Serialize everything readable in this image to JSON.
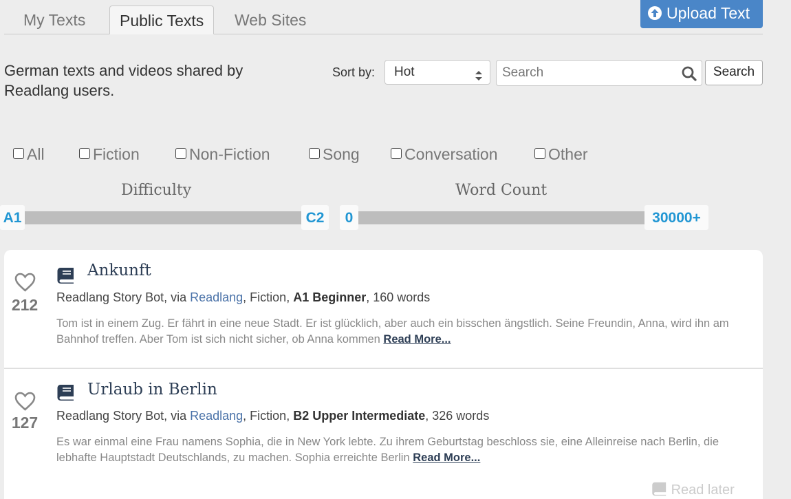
{
  "tabs": [
    {
      "label": "My Texts"
    },
    {
      "label": "Public Texts"
    },
    {
      "label": "Web Sites"
    }
  ],
  "upload_button": "Upload Text",
  "description": "German texts and videos shared by Readlang users.",
  "sort": {
    "label": "Sort by:",
    "selected": "Hot"
  },
  "search": {
    "placeholder": "Search",
    "button": "Search"
  },
  "filters": [
    "All",
    "Fiction",
    "Non-Fiction",
    "Song",
    "Conversation",
    "Other"
  ],
  "difficulty": {
    "title": "Difficulty",
    "min": "A1",
    "max": "C2"
  },
  "word_count": {
    "title": "Word Count",
    "min": "0",
    "max": "30000+"
  },
  "texts": [
    {
      "likes": "212",
      "title": "Ankunft",
      "author": "Readlang Story Bot, via ",
      "source": "Readlang",
      "genre": ", Fiction, ",
      "level": "A1 Beginner",
      "words": ", 160 words",
      "excerpt": "Tom ist in einem Zug. Er fährt in eine neue Stadt. Er ist glücklich, aber auch ein bisschen ängstlich. Seine Freundin, Anna, wird ihn am Bahnhof treffen. Aber Tom ist sich nicht sicher, ob Anna kommen ",
      "read_more": "Read More..."
    },
    {
      "likes": "127",
      "title": "Urlaub in Berlin",
      "author": "Readlang Story Bot, via ",
      "source": "Readlang",
      "genre": ", Fiction, ",
      "level": "B2 Upper Intermediate",
      "words": ", 326 words",
      "excerpt": "Es war einmal eine Frau namens Sophia, die in New York lebte. Zu ihrem Geburtstag beschloss sie, eine Alleinreise nach Berlin, die lebhafte Hauptstadt Deutschlands, zu machen. Sophia erreichte Berlin ",
      "read_more": "Read More...",
      "read_later": "Read later"
    }
  ]
}
